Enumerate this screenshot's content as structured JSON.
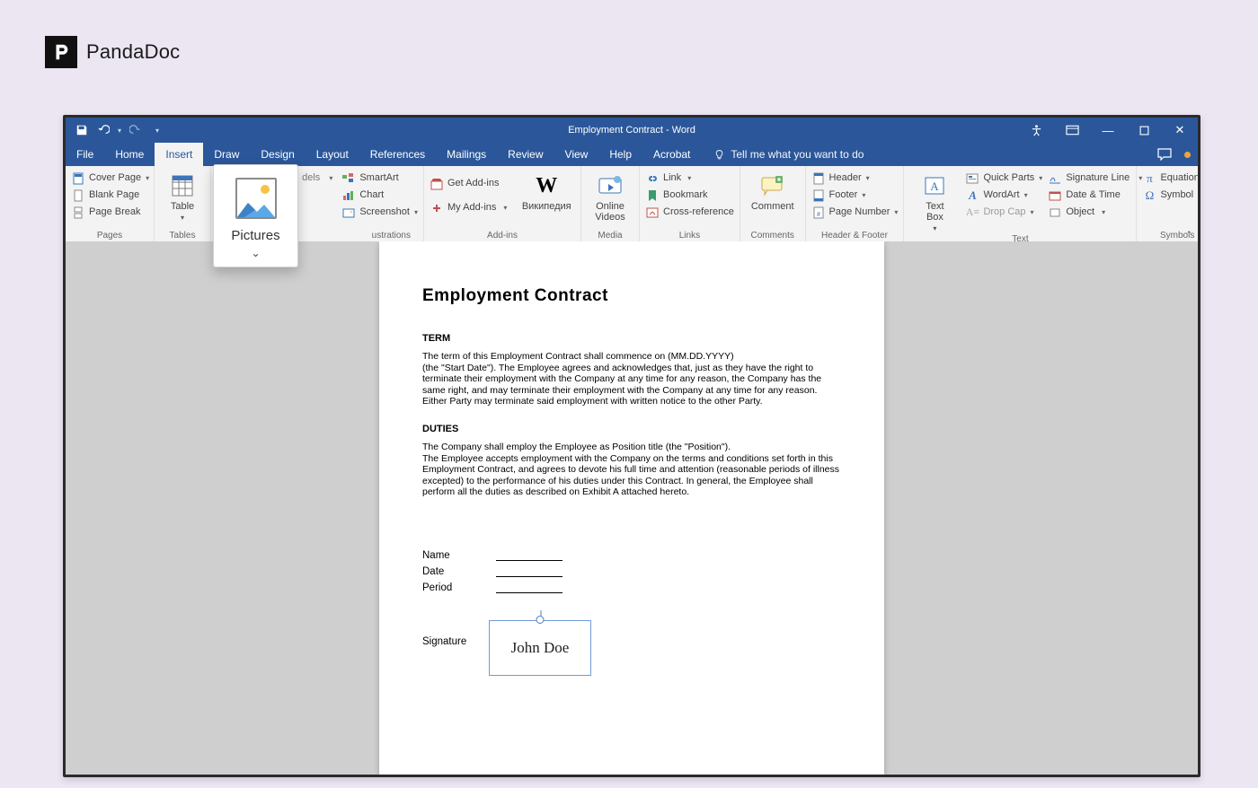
{
  "brand": {
    "name": "PandaDoc"
  },
  "titlebar": {
    "title": "Employment Contract - Word"
  },
  "tabs": {
    "file": "File",
    "home": "Home",
    "insert": "Insert",
    "draw": "Draw",
    "design": "Design",
    "layout": "Layout",
    "references": "References",
    "mailings": "Mailings",
    "review": "Review",
    "view": "View",
    "help": "Help",
    "acrobat": "Acrobat",
    "tell_me": "Tell me what you want to do"
  },
  "ribbon": {
    "pages": {
      "label": "Pages",
      "cover_page": "Cover Page",
      "blank_page": "Blank Page",
      "page_break": "Page Break"
    },
    "tables": {
      "label": "Tables",
      "table": "Table"
    },
    "illustrations": {
      "label": "Illustrations",
      "pictures": "Pictures",
      "dels": "dels",
      "smartart": "SmartArt",
      "chart": "Chart",
      "screenshot": "Screenshot"
    },
    "addins": {
      "label": "Add-ins",
      "get": "Get Add-ins",
      "my": "My Add-ins",
      "wikipedia": "Википедия"
    },
    "media": {
      "label": "Media",
      "online_videos": "Online\nVideos"
    },
    "links": {
      "label": "Links",
      "link": "Link",
      "bookmark": "Bookmark",
      "cross_reference": "Cross-reference"
    },
    "comments": {
      "label": "Comments",
      "comment": "Comment"
    },
    "header_footer": {
      "label": "Header & Footer",
      "header": "Header",
      "footer": "Footer",
      "page_number": "Page Number"
    },
    "text": {
      "label": "Text",
      "text_box": "Text\nBox",
      "quick_parts": "Quick Parts",
      "wordart": "WordArt",
      "drop_cap": "Drop Cap",
      "signature_line": "Signature Line",
      "date_time": "Date & Time",
      "object": "Object"
    },
    "symbols": {
      "label": "Symbols",
      "equation": "Equation",
      "symbol": "Symbol"
    }
  },
  "document": {
    "title": "Employment  Contract",
    "term_h": "TERM",
    "term_p1": "The term of this Employment Contract shall commence on (MM.DD.YYYY)",
    "term_p2": "(the \"Start Date\"). The Employee agrees and acknowledges that, just as they have the right to terminate their employment with the Company at any time for any reason, the Company has the same right, and may terminate their employment with the Company at any time for any reason. Either Party may terminate said employment with written notice to the other Party.",
    "duties_h": "DUTIES",
    "duties_p1": "The Company shall employ the Employee as Position title (the \"Position\").",
    "duties_p2": "The Employee accepts employment with the Company on the terms and conditions set forth in this Employment Contract, and agrees to devote his full time and attention (reasonable periods of illness excepted) to the performance of his duties under this Contract. In general, the Employee shall perform all the duties as described on Exhibit A attached hereto.",
    "field_name": "Name",
    "field_date": "Date",
    "field_period": "Period",
    "field_signature": "Signature",
    "signature_value": "John Doe"
  }
}
